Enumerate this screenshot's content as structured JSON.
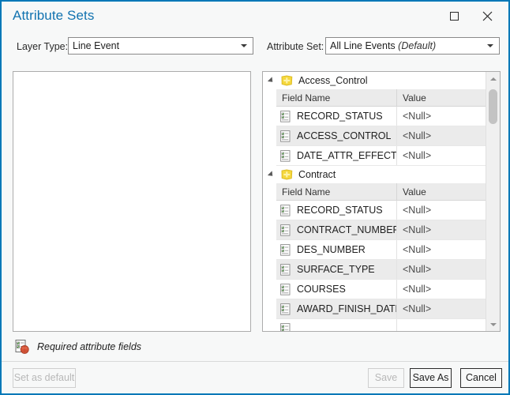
{
  "window": {
    "title": "Attribute Sets",
    "controls": {
      "maximize": "maximize-icon",
      "close": "✕"
    }
  },
  "selectors": {
    "layer_type": {
      "label": "Layer Type:",
      "value": "Line Event"
    },
    "attribute_set": {
      "label": "Attribute Set:",
      "value": "All Line Events",
      "suffix": "(Default)"
    }
  },
  "tree": {
    "columns": {
      "field_name": "Field Name",
      "value": "Value"
    },
    "groups": [
      {
        "name": "Access_Control",
        "icon": "attribute-group-icon",
        "fields": [
          {
            "name": "RECORD_STATUS",
            "value": "<Null>"
          },
          {
            "name": "ACCESS_CONTROL",
            "value": "<Null>"
          },
          {
            "name": "DATE_ATTR_EFFECTIVE",
            "value": "<Null>"
          }
        ]
      },
      {
        "name": "Contract",
        "icon": "attribute-group-icon",
        "fields": [
          {
            "name": "RECORD_STATUS",
            "value": "<Null>"
          },
          {
            "name": "CONTRACT_NUMBER",
            "value": "<Null>"
          },
          {
            "name": "DES_NUMBER",
            "value": "<Null>"
          },
          {
            "name": "SURFACE_TYPE",
            "value": "<Null>"
          },
          {
            "name": "COURSES",
            "value": "<Null>"
          },
          {
            "name": "AWARD_FINISH_DATE",
            "value": "<Null>"
          },
          {
            "name": "",
            "value": ""
          }
        ]
      }
    ]
  },
  "note": {
    "text": "Required attribute fields",
    "icon": "required-field-icon"
  },
  "footer": {
    "set_as_default": "Set as default",
    "save": "Save",
    "save_as": "Save As",
    "cancel": "Cancel"
  },
  "colors": {
    "accent": "#0078b7",
    "title": "#1273b0",
    "group_icon": "#f5d73c",
    "required_badge": "#d9563a"
  }
}
